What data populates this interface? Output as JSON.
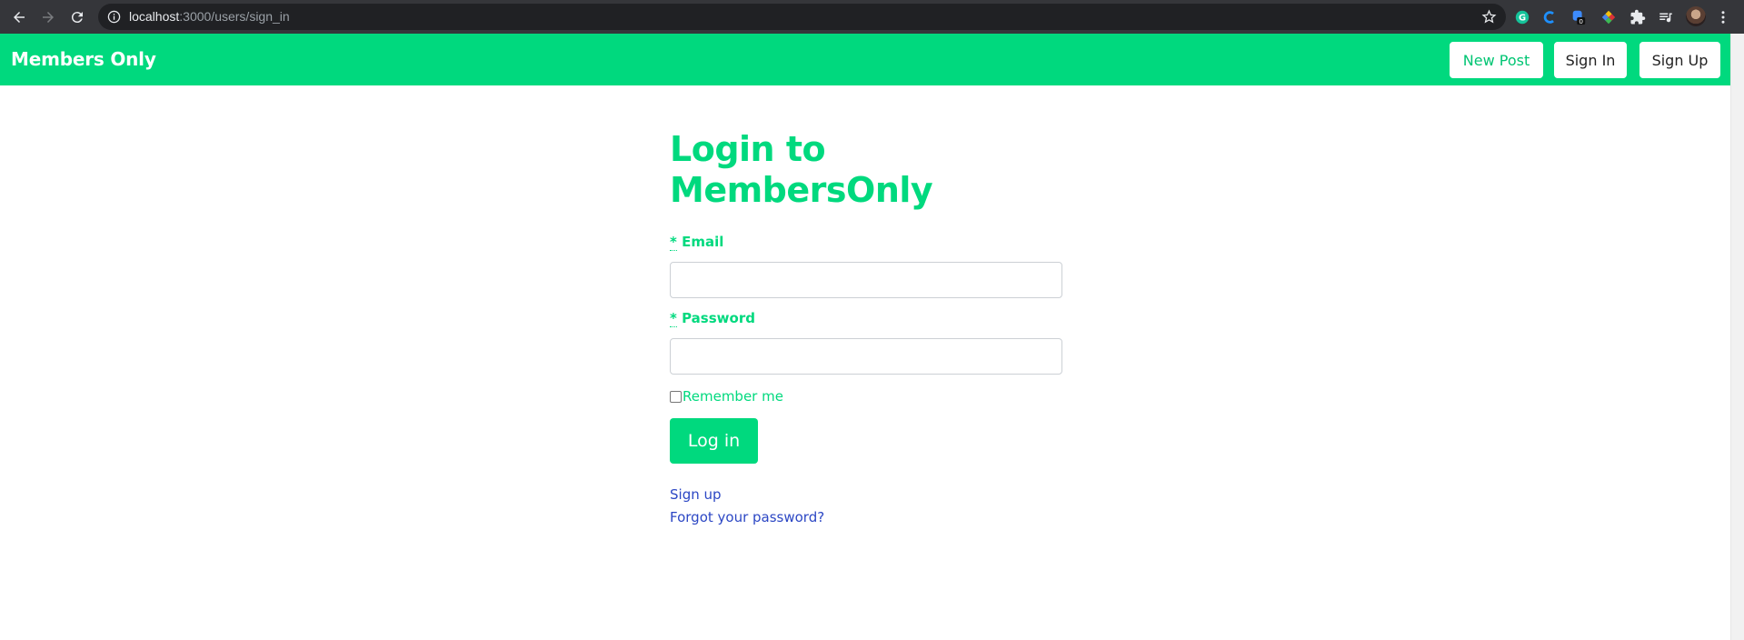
{
  "browser": {
    "url_host": "localhost",
    "url_path": ":3000/users/sign_in",
    "extension_badge": "0"
  },
  "navbar": {
    "brand": "Members Only",
    "new_post": "New Post",
    "sign_in": "Sign In",
    "sign_up": "Sign Up",
    "color": "#00d97e"
  },
  "form": {
    "title": "Login to MembersOnly",
    "required_mark": "*",
    "email_label": "Email",
    "password_label": "Password",
    "email_value": "",
    "password_value": "",
    "remember_label": "Remember me",
    "remember_checked": false,
    "submit_label": "Log in"
  },
  "links": {
    "sign_up": "Sign up",
    "forgot_password": "Forgot your password?"
  },
  "colors": {
    "accent": "#00d97e",
    "link": "#2c47c4"
  }
}
